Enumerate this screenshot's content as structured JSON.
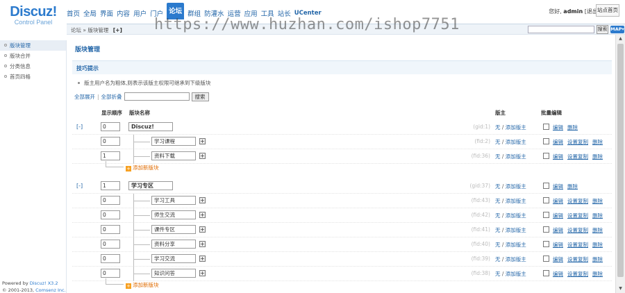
{
  "logo": {
    "main": "Discuz!",
    "sub": "Control Panel"
  },
  "topnav": [
    "首页",
    "全局",
    "界面",
    "内容",
    "用户",
    "门户",
    "论坛",
    "群组",
    "防灌水",
    "运营",
    "应用",
    "工具",
    "站长",
    "UCenter"
  ],
  "user": {
    "greeting": "您好,",
    "name": "admin",
    "logout": "[退出]",
    "home": "站点首页"
  },
  "breadcrumb": {
    "text": "论坛 » 版块管理",
    "plus": "[+]"
  },
  "top_search": {
    "button": "搜索",
    "map": "MAP"
  },
  "watermark": "https://www.huzhan.com/ishop7751",
  "sidebar": {
    "items": [
      "版块管理",
      "版块合并",
      "分类信息",
      "首页四格"
    ],
    "powered_line1_a": "Powered by ",
    "powered_line1_b": "Discuz! X3.2",
    "powered_line2_a": "© 2001-2013, ",
    "powered_line2_b": "Comsenz Inc."
  },
  "main": {
    "title": "版块管理",
    "tip_title": "技巧提示",
    "tip_text": "版主用户名为粗体,则表示该版主权限可继承到下级版块",
    "expand_all": "全部展开",
    "collapse_all": "全部折叠",
    "search_button": "搜索",
    "col_order": "显示顺序",
    "col_name": "版块名称",
    "col_moderator": "版主",
    "col_batch": "批量编辑",
    "mod_none": "无",
    "mod_add": "添加版主",
    "op_edit": "编辑",
    "op_copy": "设置复制",
    "op_delete": "删除",
    "add_forum": "添加新版块"
  },
  "groups": [
    {
      "expand": "[-]",
      "order": "0",
      "name": "Discuz!",
      "fid": "(gid:1)",
      "children": [
        {
          "order": "0",
          "name": "学习课程",
          "fid": "(fid:2)"
        },
        {
          "order": "1",
          "name": "资料下载",
          "fid": "(fid:36)"
        }
      ]
    },
    {
      "expand": "[-]",
      "order": "1",
      "name": "学习专区",
      "fid": "(gid:37)",
      "children": [
        {
          "order": "0",
          "name": "学习工具",
          "fid": "(fid:43)"
        },
        {
          "order": "0",
          "name": "师生交流",
          "fid": "(fid:42)"
        },
        {
          "order": "0",
          "name": "课件专区",
          "fid": "(fid:41)"
        },
        {
          "order": "0",
          "name": "资料分享",
          "fid": "(fid:40)"
        },
        {
          "order": "0",
          "name": "学习交流",
          "fid": "(fid:39)"
        },
        {
          "order": "0",
          "name": "知识问答",
          "fid": "(fid:38)"
        }
      ]
    }
  ]
}
